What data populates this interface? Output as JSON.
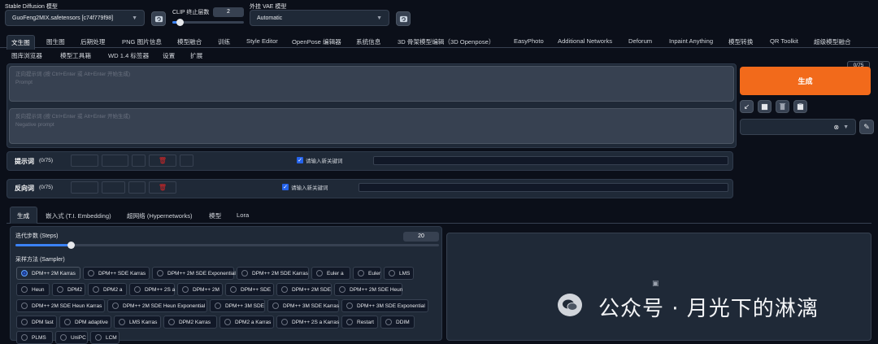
{
  "top": {
    "model_label": "Stable Diffusion 模型",
    "model_value": "GuoFeng2MIX.safetensors [c74f779f98]",
    "clip_label": "CLIP 终止层数",
    "clip_value": "2",
    "clip_fraction": 0.1,
    "vae_label": "外挂 VAE 模型",
    "vae_value": "Automatic"
  },
  "tabs_row1": [
    "文生图",
    "图生图",
    "后期处理",
    "PNG 图片信息",
    "模型融合",
    "训练",
    "Style Editor",
    "OpenPose 编辑器",
    "系统信息",
    "3D 骨架模型编辑（3D Openpose）",
    "EasyPhoto",
    "Additional Networks",
    "Deforum",
    "Inpaint Anything",
    "模型转换",
    "QR Toolkit",
    "超级模型融合"
  ],
  "tabs_row2": [
    "图库浏览器",
    "模型工具箱",
    "WD 1.4 标签器",
    "设置",
    "扩展"
  ],
  "prompt": {
    "placeholder_line1": "正向提示词 (按 Ctrl+Enter 或 Alt+Enter 开始生成)",
    "placeholder_line2": "Prompt",
    "counter": "0/75"
  },
  "negative": {
    "placeholder_line1": "反向提示词 (按 Ctrl+Enter 或 Alt+Enter 开始生成)",
    "placeholder_line2": "Negative prompt"
  },
  "generate_label": "生成",
  "keyword_rows": [
    {
      "label": "提示词",
      "count": "(0/75)",
      "check_label": "请输入新关键词"
    },
    {
      "label": "反向词",
      "count": "(0/75)",
      "check_label": "请输入新关键词"
    }
  ],
  "sub_tabs": [
    "生成",
    "嵌入式 (T.I. Embedding)",
    "超网络 (Hypernetworks)",
    "模型",
    "Lora"
  ],
  "steps": {
    "label": "迭代步数 (Steps)",
    "value": "20",
    "fraction": 0.13
  },
  "sampler": {
    "label": "采样方法 (Sampler)",
    "selected": "DPM++ 2M Karras",
    "options": [
      "DPM++ 2M Karras",
      "DPM++ SDE Karras",
      "DPM++ 2M SDE Exponential",
      "DPM++ 2M SDE Karras",
      "Euler a",
      "Euler",
      "LMS",
      "Heun",
      "DPM2",
      "DPM2 a",
      "DPM++ 2S a",
      "DPM++ 2M",
      "DPM++ SDE",
      "DPM++ 2M SDE",
      "DPM++ 2M SDE Heun",
      "DPM++ 2M SDE Heun Karras",
      "DPM++ 2M SDE Heun Exponential",
      "DPM++ 3M SDE",
      "DPM++ 3M SDE Karras",
      "DPM++ 3M SDE Exponential",
      "DPM fast",
      "DPM adaptive",
      "LMS Karras",
      "DPM2 Karras",
      "DPM2 a Karras",
      "DPM++ 2S a Karras",
      "Restart",
      "DDIM",
      "PLMS",
      "UniPC",
      "LCM"
    ]
  },
  "watermark": "公众号 · 月光下的淋漓",
  "colors": {
    "accent": "#f26a1b",
    "background": "#0b0f19",
    "panel": "#1f2937"
  }
}
